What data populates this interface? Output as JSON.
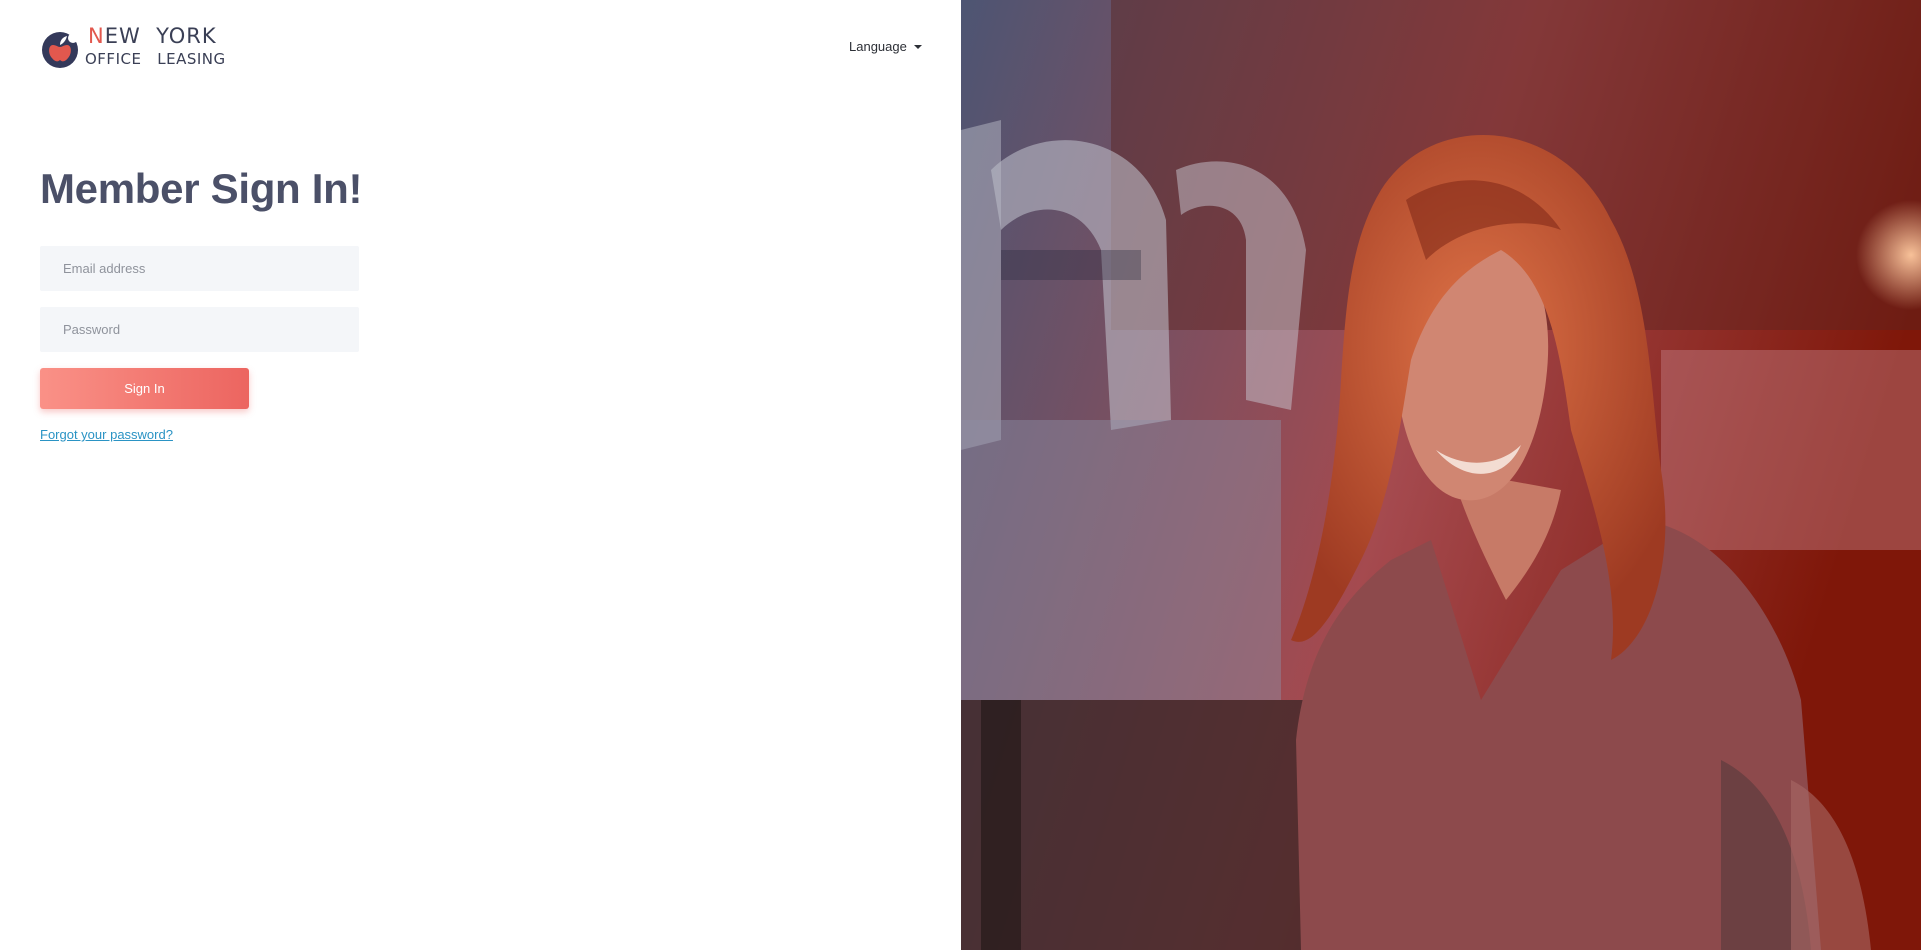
{
  "logo": {
    "icon": "apple-logo-icon",
    "line1_accent": "N",
    "line1_rest": "EW  YORK",
    "line2": "OFFICE   LEASING",
    "colors": {
      "text": "#3a3f55",
      "accent": "#e2584e"
    }
  },
  "header": {
    "language_label": "Language",
    "language_icon": "caret-down-icon"
  },
  "form": {
    "title": "Member Sign In!",
    "email_placeholder": "Email address",
    "email_value": "",
    "password_placeholder": "Password",
    "password_value": "",
    "signin_label": "Sign In",
    "forgot_label": "Forgot your password?"
  },
  "hero": {
    "image": "smiling-woman-red-tinted-photo",
    "overlay_colors": [
      "#4d5573",
      "#a54a4f",
      "#7f1709"
    ]
  },
  "theme": {
    "title_color": "#4b5068",
    "button_gradient": [
      "#fa9187",
      "#ec6560"
    ],
    "link_color": "#2a93c4",
    "field_bg": "#f4f6f9"
  }
}
